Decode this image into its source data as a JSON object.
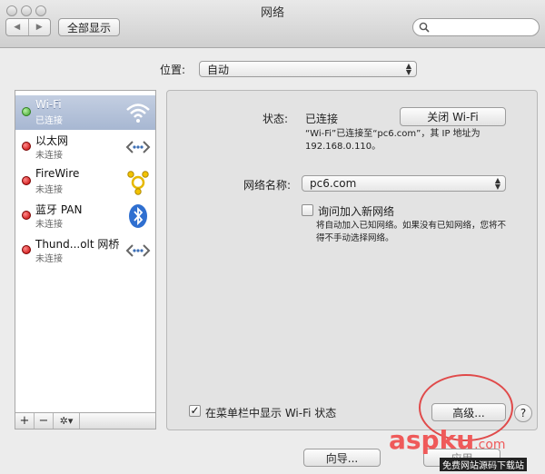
{
  "window": {
    "title": "网络"
  },
  "toolbar": {
    "back_icon": "◀",
    "forward_icon": "▶",
    "show_all": "全部显示",
    "search_placeholder": ""
  },
  "location": {
    "label": "位置:",
    "value": "自动"
  },
  "sidebar": {
    "items": [
      {
        "name": "Wi-Fi",
        "status": "已连接",
        "dot": "green",
        "icon": "wifi-icon",
        "selected": true
      },
      {
        "name": "以太网",
        "status": "未连接",
        "dot": "red",
        "icon": "ethernet-icon",
        "selected": false
      },
      {
        "name": "FireWire",
        "status": "未连接",
        "dot": "red",
        "icon": "firewire-icon",
        "selected": false
      },
      {
        "name": "蓝牙 PAN",
        "status": "未连接",
        "dot": "red",
        "icon": "bluetooth-icon",
        "selected": false
      },
      {
        "name": "Thund...olt 网桥",
        "status": "未连接",
        "dot": "red",
        "icon": "thunderbolt-bridge-icon",
        "selected": false
      }
    ],
    "add": "+",
    "remove": "−",
    "action": "✲▾"
  },
  "detail": {
    "status_label": "状态:",
    "status_value": "已连接",
    "turn_off_button": "关闭 Wi-Fi",
    "status_desc_line1": "“Wi-Fi”已连接至“pc6.com”，其 IP 地址为",
    "status_desc_line2": "192.168.0.110。",
    "network_name_label": "网络名称:",
    "network_name_value": "pc6.com",
    "ask_join_label": "询问加入新网络",
    "ask_join_desc_line1": "将自动加入已知网络。如果没有已知网络，您将不",
    "ask_join_desc_line2": "得不手动选择网络。",
    "show_in_menubar_label": "在菜单栏中显示 Wi-Fi 状态",
    "show_in_menubar_checked": "✓",
    "advanced_button": "高级...",
    "help": "?"
  },
  "footer": {
    "assist_button": "向导...",
    "apply_button": "应用"
  },
  "watermark": {
    "text": "aspku",
    "suffix": ".com",
    "subtitle": "免费网站源码下载站"
  },
  "colors": {
    "selection": "#a7b7d2",
    "status_green": "#3fa32a",
    "status_red": "#c40000",
    "highlight_ring": "#e04a4a"
  }
}
